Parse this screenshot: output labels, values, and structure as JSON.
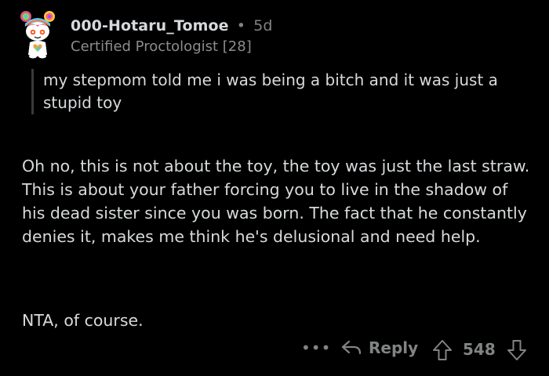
{
  "comment": {
    "author": "000-Hotaru_Tomoe",
    "separator": "•",
    "age": "5d",
    "flair": "Certified Proctologist [28]",
    "quote": "my stepmom told me i was being a bitch and it was just a stupid toy",
    "body_paragraph_1": "Oh no, this is not about the toy, the toy was just the last straw. This is about your father forcing you to live in the shadow of his dead sister since you was born. The fact that he constantly denies it, makes me think he's delusional and need help.",
    "body_paragraph_2": "NTA, of course."
  },
  "actions": {
    "more": "•••",
    "reply_label": "Reply",
    "score": "548"
  },
  "icons": {
    "avatar": "snoo-avatar-rainbow-hair",
    "more": "more-dots-icon",
    "reply": "reply-arrow-icon",
    "upvote": "upvote-arrow-icon",
    "downvote": "downvote-arrow-icon"
  },
  "colors": {
    "background": "#000000",
    "text": "#d7dadc",
    "muted": "#818384"
  }
}
